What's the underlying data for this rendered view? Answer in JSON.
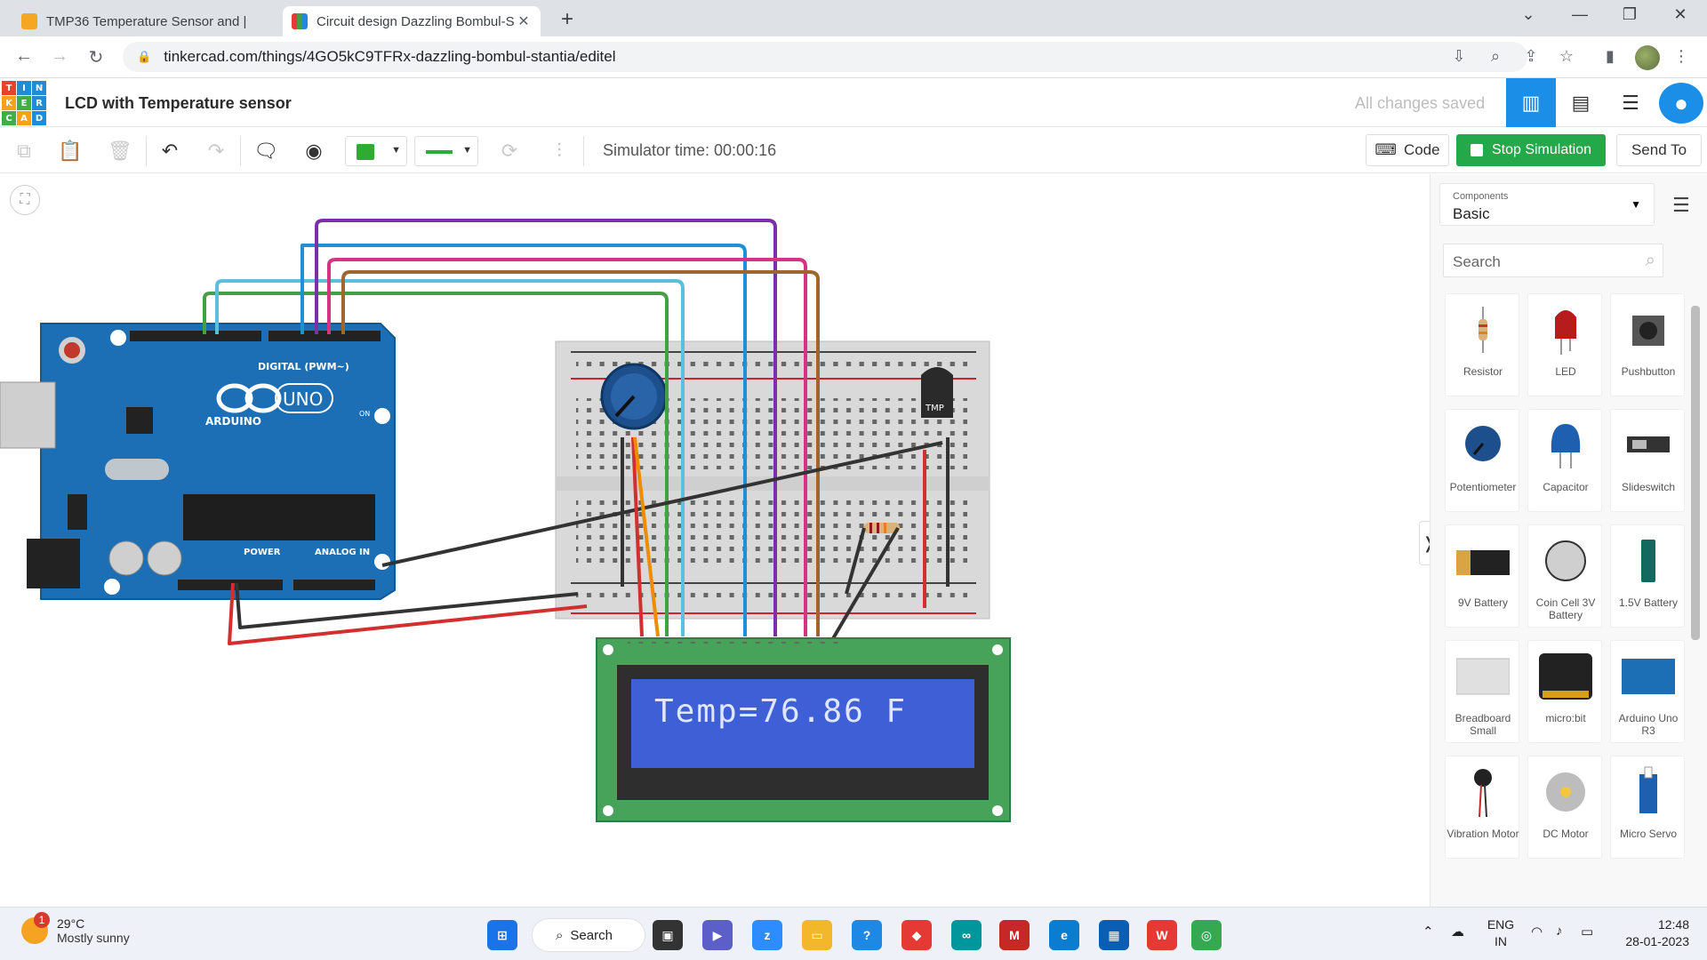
{
  "browser": {
    "tabs": [
      {
        "label": "TMP36 Temperature Sensor and |",
        "active": false
      },
      {
        "label": "Circuit design Dazzling Bombul-S",
        "active": true
      }
    ],
    "url": "tinkercad.com/things/4GO5kC9TFRx-dazzling-bombul-stantia/editel"
  },
  "app": {
    "logo_letters": [
      "T",
      "I",
      "N",
      "K",
      "E",
      "R",
      "C",
      "A",
      "D"
    ],
    "project_title": "LCD with Temperature sensor",
    "save_status": "All changes saved"
  },
  "toolbar": {
    "simulator_time": "Simulator time: 00:00:16",
    "code_label": "Code",
    "stop_label": "Stop Simulation",
    "send_label": "Send To",
    "wire_color": "#2fab33"
  },
  "canvas": {
    "lcd_text": "Temp=76.86 F",
    "arduino": {
      "brand": "ARDUINO",
      "model": "UNO",
      "digital_label": "DIGITAL (PWM~)",
      "power_label": "POWER",
      "analog_label": "ANALOG IN",
      "on_label": "ON"
    },
    "sensor_label": "TMP"
  },
  "panel": {
    "components_label": "Components",
    "components_value": "Basic",
    "search_placeholder": "Search",
    "items": [
      {
        "label": "Resistor",
        "icon": "resistor-icon"
      },
      {
        "label": "LED",
        "icon": "led-icon"
      },
      {
        "label": "Pushbutton",
        "icon": "pushbutton-icon"
      },
      {
        "label": "Potentiometer",
        "icon": "potentiometer-icon"
      },
      {
        "label": "Capacitor",
        "icon": "capacitor-icon"
      },
      {
        "label": "Slideswitch",
        "icon": "slideswitch-icon"
      },
      {
        "label": "9V Battery",
        "icon": "battery-9v-icon"
      },
      {
        "label": "Coin Cell 3V Battery",
        "icon": "coin-cell-icon"
      },
      {
        "label": "1.5V Battery",
        "icon": "battery-aa-icon"
      },
      {
        "label": "Breadboard Small",
        "icon": "breadboard-icon"
      },
      {
        "label": "micro:bit",
        "icon": "microbit-icon"
      },
      {
        "label": "Arduino Uno R3",
        "icon": "arduino-icon"
      },
      {
        "label": "Vibration Motor",
        "icon": "vibration-motor-icon"
      },
      {
        "label": "DC Motor",
        "icon": "dc-motor-icon"
      },
      {
        "label": "Micro Servo",
        "icon": "servo-icon"
      }
    ]
  },
  "taskbar": {
    "weather_temp": "29°C",
    "weather_desc": "Mostly sunny",
    "weather_badge": "1",
    "search_label": "Search",
    "lang_top": "ENG",
    "lang_bottom": "IN",
    "time": "12:48",
    "date": "28-01-2023"
  }
}
